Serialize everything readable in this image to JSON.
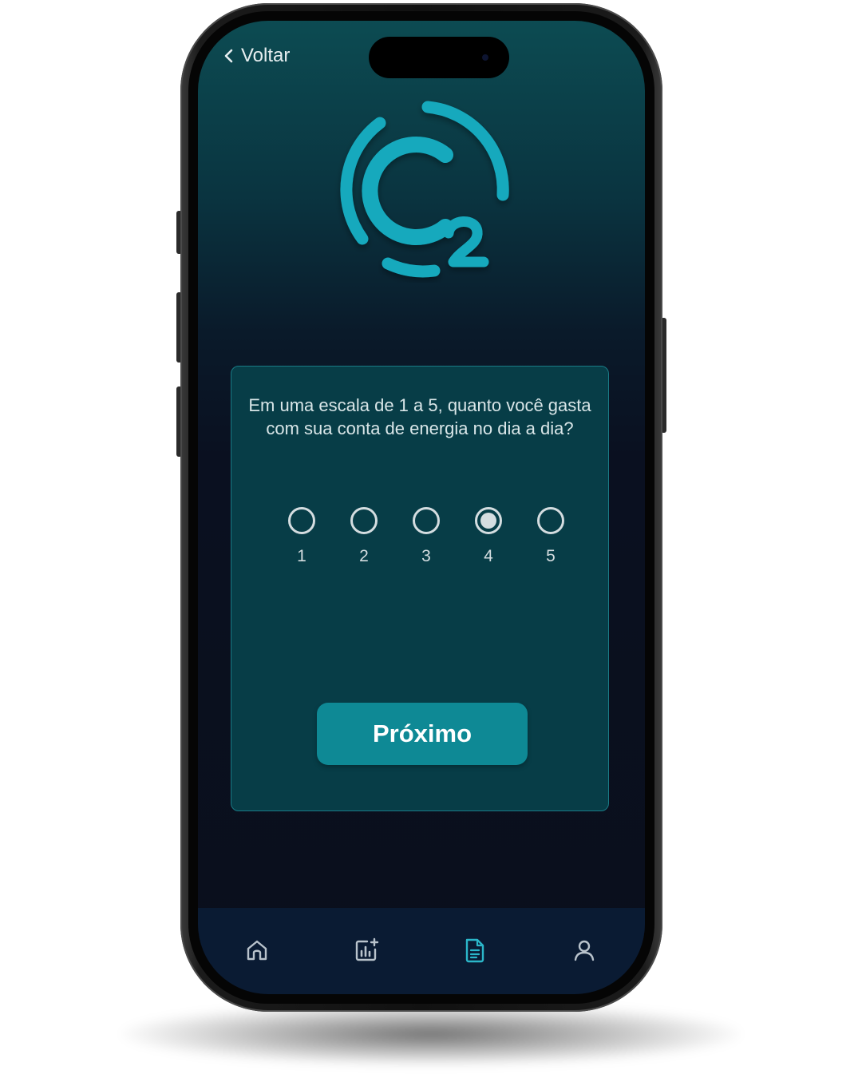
{
  "nav": {
    "back_label": "Voltar"
  },
  "logo": {
    "name": "c2-logo-icon",
    "color": "#13a9bd"
  },
  "question": {
    "text": "Em uma escala de 1 a 5, quanto você gasta com sua conta de energia no dia a dia?",
    "options": [
      {
        "label": "1",
        "selected": false
      },
      {
        "label": "2",
        "selected": false
      },
      {
        "label": "3",
        "selected": false
      },
      {
        "label": "4",
        "selected": true
      },
      {
        "label": "5",
        "selected": false
      }
    ]
  },
  "actions": {
    "next_label": "Próximo"
  },
  "tabbar": {
    "items": [
      {
        "icon": "home-icon",
        "active": false
      },
      {
        "icon": "chart-add-icon",
        "active": false
      },
      {
        "icon": "document-icon",
        "active": true
      },
      {
        "icon": "user-icon",
        "active": false
      }
    ]
  },
  "colors": {
    "accent": "#0e8995",
    "active_icon": "#2bb6c9",
    "inactive_icon": "#b9c3cc"
  }
}
